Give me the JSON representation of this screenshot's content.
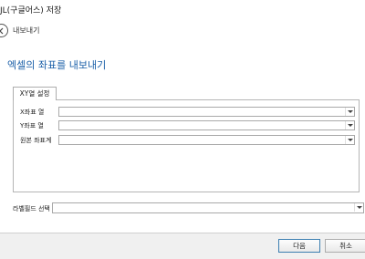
{
  "window": {
    "title": "JL(구글어스) 저장"
  },
  "nav": {
    "back_label": "내보내기"
  },
  "page": {
    "heading": "엑셀의 좌표를 내보내기"
  },
  "tabs": [
    {
      "label": "XY열 설정",
      "selected": true
    }
  ],
  "xy_settings": {
    "x_column": {
      "label": "X좌표 열",
      "value": ""
    },
    "y_column": {
      "label": "Y좌표 열",
      "value": ""
    },
    "source_crs": {
      "label": "원본 좌표계",
      "value": ""
    }
  },
  "label_field": {
    "label": "라벨필드 선택",
    "value": ""
  },
  "footer": {
    "next_label": "다음",
    "cancel_label": "취소"
  },
  "colors": {
    "heading": "#1a5fa8",
    "primary_border": "#3c7fb1"
  }
}
